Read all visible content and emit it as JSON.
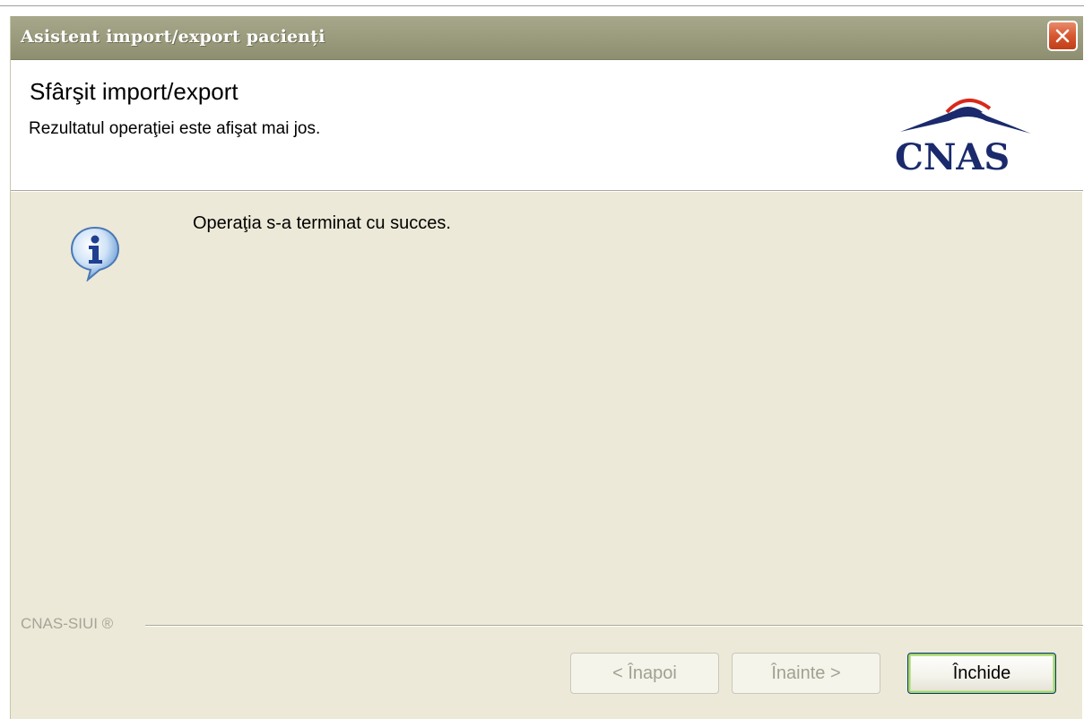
{
  "window": {
    "title": "Asistent import/export pacienți"
  },
  "header": {
    "title": "Sfârşit import/export",
    "subtitle": "Rezultatul operaţiei este afişat mai jos.",
    "logo_text": "CNAS"
  },
  "content": {
    "icon": "info-icon",
    "message": "Operaţia s-a terminat cu succes."
  },
  "footer": {
    "brand": "CNAS-SIUI ®",
    "buttons": {
      "back_label": "< Înapoi",
      "next_label": "Înainte >",
      "close_label": "Închide"
    }
  },
  "colors": {
    "titlebar": "#9c9c7f",
    "dialog_bg": "#ece9d8",
    "logo_navy": "#1a2a6c",
    "logo_red": "#d8291c"
  }
}
